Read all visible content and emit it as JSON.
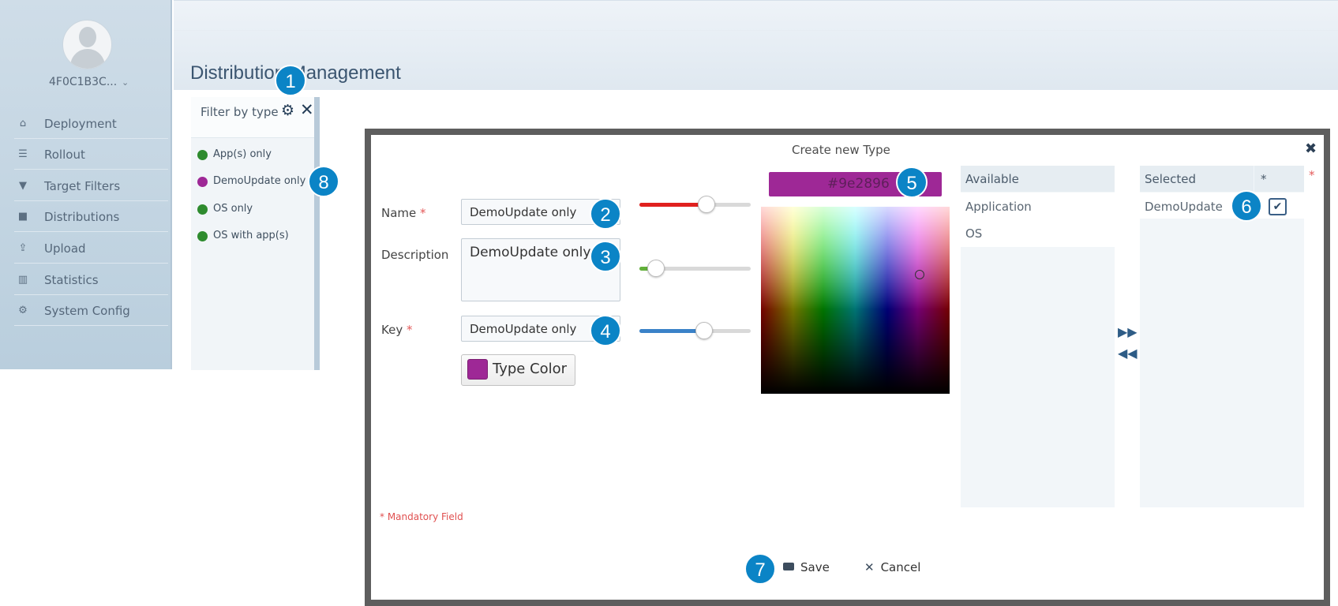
{
  "sidebar": {
    "user_name": "4F0C1B3C...",
    "items": [
      {
        "label": "Deployment",
        "icon": "home-icon"
      },
      {
        "label": "Rollout",
        "icon": "list-icon"
      },
      {
        "label": "Target Filters",
        "icon": "filter-icon"
      },
      {
        "label": "Distributions",
        "icon": "briefcase-icon"
      },
      {
        "label": "Upload",
        "icon": "upload-icon"
      },
      {
        "label": "Statistics",
        "icon": "bar-chart-icon"
      },
      {
        "label": "System Config",
        "icon": "gear-icon"
      }
    ]
  },
  "page": {
    "title": "Distribution Management"
  },
  "filter_panel": {
    "title": "Filter by type",
    "types": [
      {
        "label": "App(s) only",
        "color": "#2e8b2e"
      },
      {
        "label": "DemoUpdate only",
        "color": "#9e2896"
      },
      {
        "label": "OS only",
        "color": "#2e8b2e"
      },
      {
        "label": "OS with app(s)",
        "color": "#2e8b2e"
      }
    ]
  },
  "dialog": {
    "title": "Create new Type",
    "name_label": "Name",
    "name_value": "DemoUpdate only",
    "description_label": "Description",
    "description_value": "DemoUpdate only",
    "key_label": "Key",
    "key_value": "DemoUpdate only",
    "required_mark": "*",
    "type_color_label": "Type Color",
    "color_hex": "#9e2896",
    "sliders": {
      "red_fraction": 0.6,
      "green_fraction": 0.15,
      "blue_fraction": 0.58
    },
    "available": {
      "header": "Available",
      "items": [
        "Application",
        "OS"
      ]
    },
    "selected": {
      "header": "Selected",
      "star_header": "*",
      "items": [
        {
          "label": "DemoUpdate",
          "checked": true
        }
      ]
    },
    "mandatory_note": "* Mandatory Field",
    "save_label": "Save",
    "cancel_label": "Cancel"
  },
  "callouts": [
    "1",
    "2",
    "3",
    "4",
    "5",
    "6",
    "7",
    "8"
  ],
  "colors": {
    "accent": "#0b84c6",
    "red_slider": "#e0201e",
    "green_slider": "#62b03a",
    "blue_slider": "#3a82c8"
  }
}
